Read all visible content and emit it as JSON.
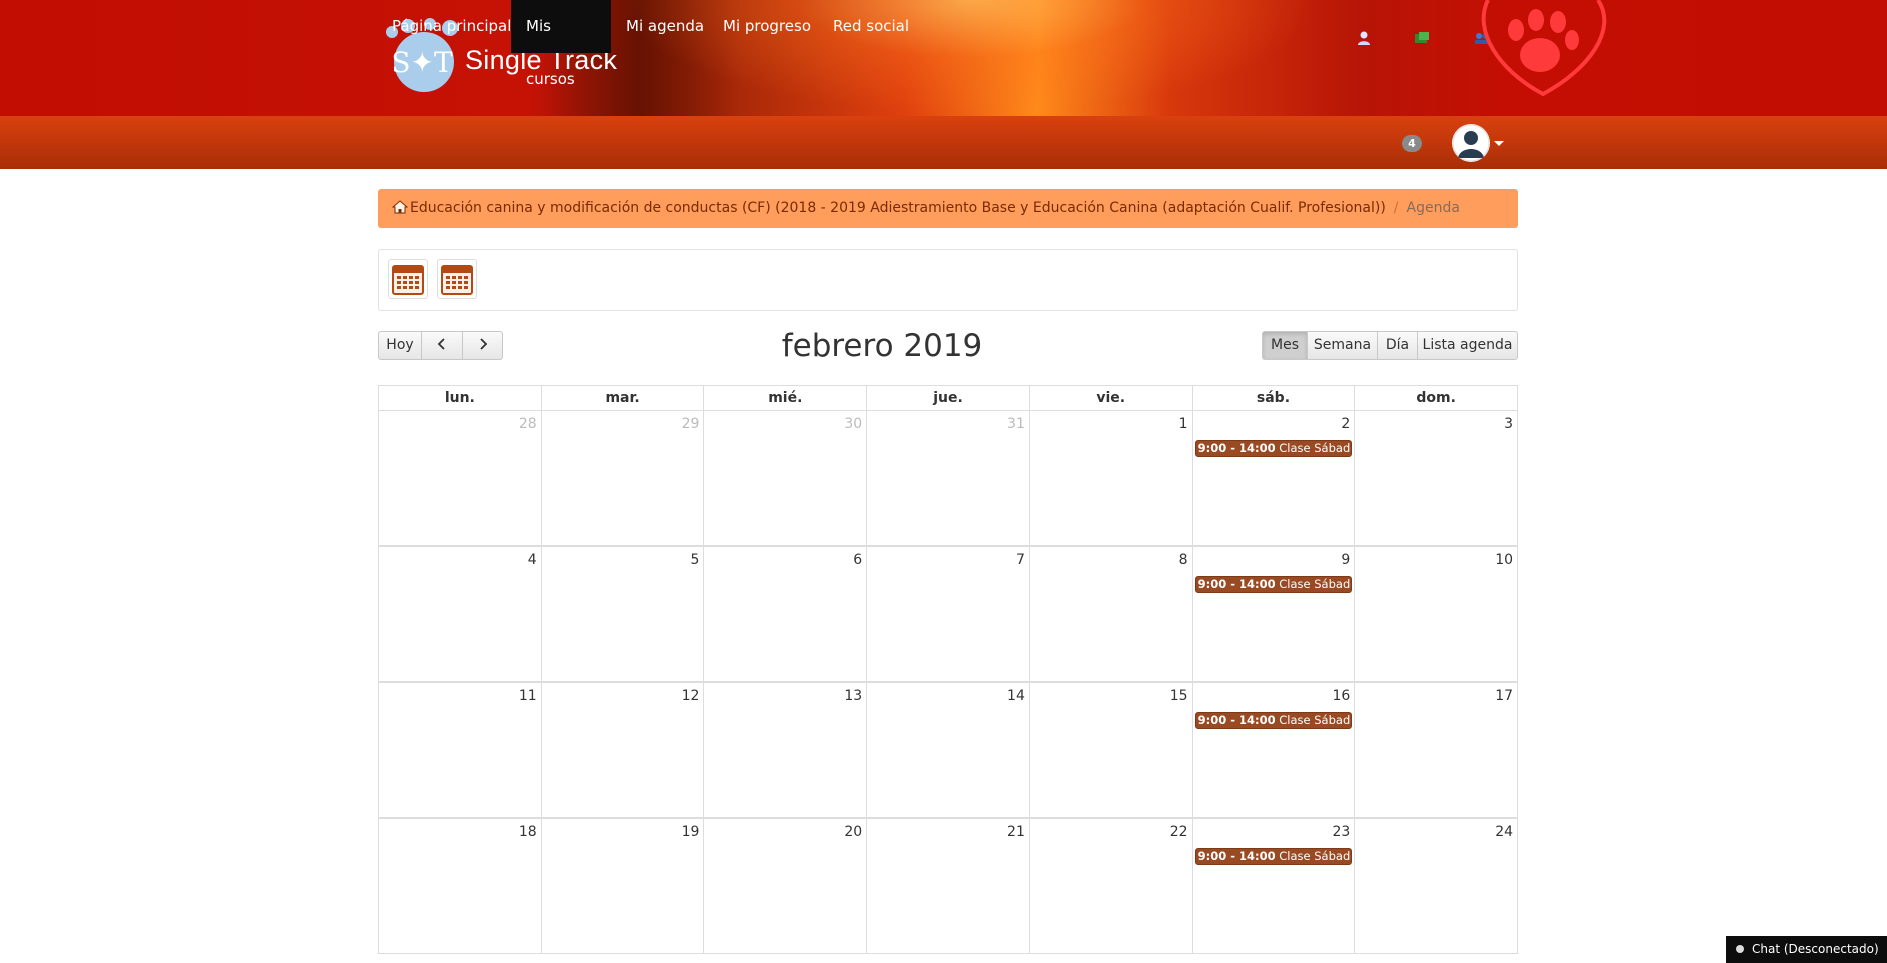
{
  "brand": {
    "name": "Single Track",
    "logo_letters": "S✦T"
  },
  "nav": {
    "items": [
      {
        "label": "Página principal"
      },
      {
        "label": "Mis cursos",
        "active": true
      },
      {
        "label": "Mi agenda"
      },
      {
        "label": "Mi progreso"
      },
      {
        "label": "Red social"
      }
    ],
    "notifications_count": "4"
  },
  "breadcrumb": {
    "course": "Educación canina y modificación de conductas (CF) (2018 - 2019 Adiestramiento Base y Educación Canina (adaptación Cualif. Profesional))",
    "separator": "/",
    "current": "Agenda"
  },
  "calendar": {
    "title": "febrero 2019",
    "today_label": "Hoy",
    "prev_icon": "chevron-left-icon",
    "next_icon": "chevron-right-icon",
    "views": [
      {
        "label": "Mes",
        "active": true
      },
      {
        "label": "Semana"
      },
      {
        "label": "Día"
      },
      {
        "label": "Lista agenda"
      }
    ],
    "weekdays": [
      "lun.",
      "mar.",
      "mié.",
      "jue.",
      "vie.",
      "sáb.",
      "dom."
    ],
    "weeks": [
      [
        {
          "d": "28",
          "other": true
        },
        {
          "d": "29",
          "other": true
        },
        {
          "d": "30",
          "other": true
        },
        {
          "d": "31",
          "other": true
        },
        {
          "d": "1"
        },
        {
          "d": "2",
          "event": {
            "time": "9:00 - 14:00",
            "title": "Clase Sábados"
          }
        },
        {
          "d": "3"
        }
      ],
      [
        {
          "d": "4"
        },
        {
          "d": "5"
        },
        {
          "d": "6"
        },
        {
          "d": "7"
        },
        {
          "d": "8"
        },
        {
          "d": "9",
          "event": {
            "time": "9:00 - 14:00",
            "title": "Clase Sábados"
          }
        },
        {
          "d": "10"
        }
      ],
      [
        {
          "d": "11"
        },
        {
          "d": "12"
        },
        {
          "d": "13"
        },
        {
          "d": "14"
        },
        {
          "d": "15"
        },
        {
          "d": "16",
          "event": {
            "time": "9:00 - 14:00",
            "title": "Clase Sábados"
          }
        },
        {
          "d": "17"
        }
      ],
      [
        {
          "d": "18"
        },
        {
          "d": "19"
        },
        {
          "d": "20"
        },
        {
          "d": "21"
        },
        {
          "d": "22"
        },
        {
          "d": "23",
          "event": {
            "time": "9:00 - 14:00",
            "title": "Clase Sábados"
          }
        },
        {
          "d": "24"
        }
      ]
    ]
  },
  "chat": {
    "label": "Chat (Desconectado)"
  },
  "colors": {
    "banner": "#c10d02",
    "nav": "#c0360a",
    "breadcrumb": "#ff9d5c",
    "event": "#9a4a22"
  }
}
